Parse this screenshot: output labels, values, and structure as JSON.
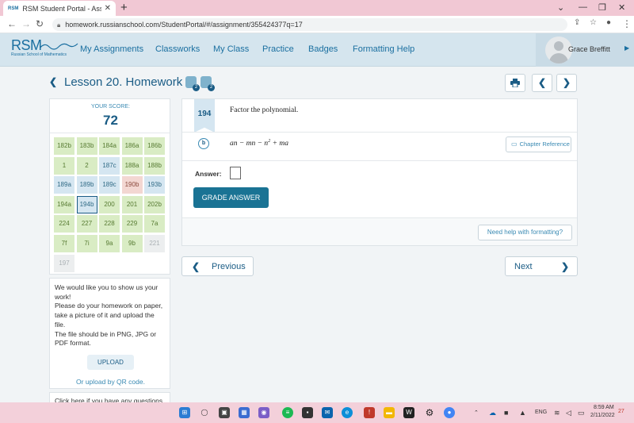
{
  "browser": {
    "tab_title": "RSM Student Portal - Assignment",
    "tab_favicon": "RSM",
    "url": "homework.russianschool.com/StudentPortal/#/assignment/355424377q=17"
  },
  "site": {
    "logo": "RSM",
    "logo_sub": "Russian School of Mathematics",
    "menu": [
      "My Assignments",
      "Classworks",
      "My Class",
      "Practice",
      "Badges",
      "Formatting Help"
    ],
    "user_name": "Grace Breffitt"
  },
  "lesson": {
    "title": "Lesson 20. Homework",
    "badge_counts": [
      "2",
      "2"
    ]
  },
  "score": {
    "label": "YOUR SCORE:",
    "value": "72",
    "problems": [
      {
        "label": "182b",
        "state": "green"
      },
      {
        "label": "183b",
        "state": "green"
      },
      {
        "label": "184a",
        "state": "green"
      },
      {
        "label": "186a",
        "state": "green"
      },
      {
        "label": "186b",
        "state": "green"
      },
      {
        "label": "1",
        "state": "green"
      },
      {
        "label": "2",
        "state": "green"
      },
      {
        "label": "187c",
        "state": "blue"
      },
      {
        "label": "188a",
        "state": "green"
      },
      {
        "label": "188b",
        "state": "green"
      },
      {
        "label": "189a",
        "state": "blue"
      },
      {
        "label": "189b",
        "state": "blue"
      },
      {
        "label": "189c",
        "state": "blue"
      },
      {
        "label": "190b",
        "state": "pink"
      },
      {
        "label": "193b",
        "state": "blue"
      },
      {
        "label": "194a",
        "state": "green"
      },
      {
        "label": "194b",
        "state": "sel"
      },
      {
        "label": "200",
        "state": "green"
      },
      {
        "label": "201",
        "state": "green"
      },
      {
        "label": "202b",
        "state": "green"
      },
      {
        "label": "224",
        "state": "green"
      },
      {
        "label": "227",
        "state": "green"
      },
      {
        "label": "228",
        "state": "green"
      },
      {
        "label": "229",
        "state": "green"
      },
      {
        "label": "7a",
        "state": "green"
      },
      {
        "label": "7f",
        "state": "green"
      },
      {
        "label": "7i",
        "state": "green"
      },
      {
        "label": "9a",
        "state": "green"
      },
      {
        "label": "9b",
        "state": "green"
      },
      {
        "label": "221",
        "state": "grey"
      },
      {
        "label": "197",
        "state": "grey"
      }
    ]
  },
  "upload": {
    "text_lines": [
      "We would like you to show us your",
      "work!",
      "Please do your homework on paper,",
      "take a picture of it and upload the",
      "file.",
      "The file should be in PNG, JPG or",
      "PDF format."
    ],
    "button": "UPLOAD",
    "qr_link": "Or upload by QR code.",
    "help_text": "Click here if you have any questions"
  },
  "question": {
    "number": "194",
    "prompt": "Factor the polynomial.",
    "part": "b",
    "expression_pre": "an − mn − n",
    "expression_exp": "2",
    "expression_post": " + ma",
    "chapter_ref": "Chapter Reference",
    "answer_label": "Answer:",
    "grade_button": "GRADE ANSWER",
    "help_formatting": "Need help with formatting?"
  },
  "pager": {
    "previous": "Previous",
    "next": "Next"
  },
  "taskbar": {
    "lang": "ENG",
    "time": "8:59 AM",
    "date": "2/11/2022",
    "notif_count": "27"
  }
}
